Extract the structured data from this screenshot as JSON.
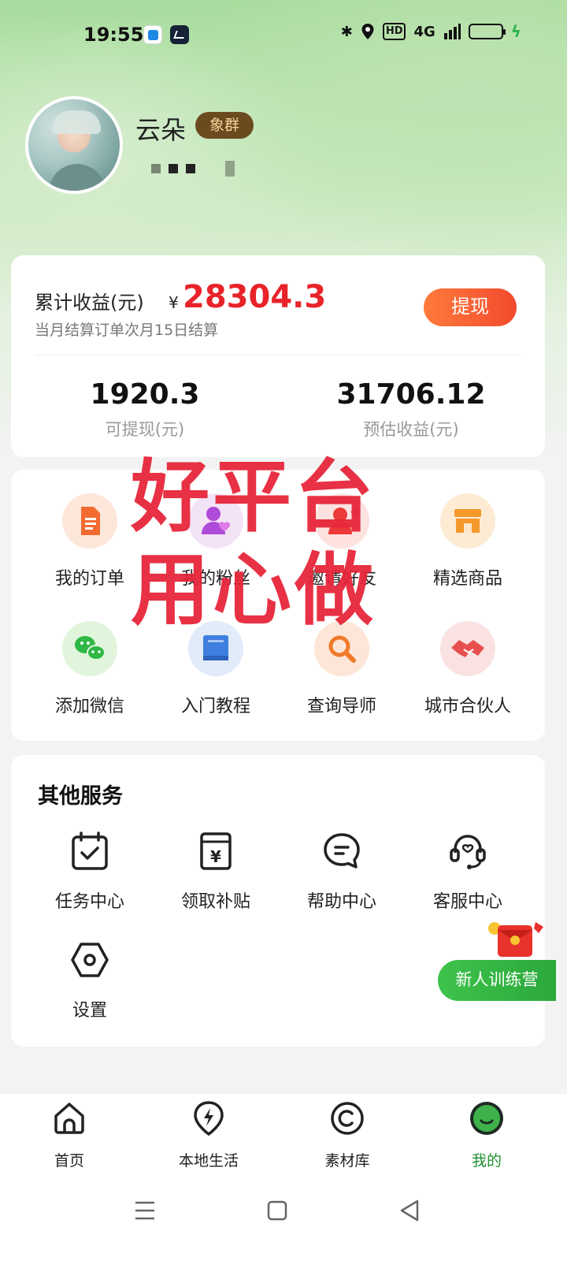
{
  "status_bar": {
    "time": "19:55",
    "network": "4G",
    "hd": "HD"
  },
  "profile": {
    "username": "云朵",
    "level_badge": "象群"
  },
  "earnings": {
    "title": "累计收益(元)",
    "currency": "¥",
    "total": "28304.3",
    "note": "当月结算订单次月15日结算",
    "withdraw_label": "提现",
    "stats": [
      {
        "value": "1920.3",
        "label": "可提现(元)"
      },
      {
        "value": "31706.12",
        "label": "预估收益(元)"
      }
    ]
  },
  "overlay": {
    "line1": "好平台",
    "line2": "用心做"
  },
  "features": [
    {
      "label": "我的订单",
      "icon": "order-doc-icon",
      "color": "#f26b30"
    },
    {
      "label": "我的粉丝",
      "icon": "fans-heart-icon",
      "color": "#b04ad8"
    },
    {
      "label": "邀请好友",
      "icon": "invite-friend-icon",
      "color": "#ec3a3a"
    },
    {
      "label": "精选商品",
      "icon": "store-icon",
      "color": "#f5992b"
    },
    {
      "label": "添加微信",
      "icon": "wechat-icon",
      "color": "#2fb845"
    },
    {
      "label": "入门教程",
      "icon": "book-icon",
      "color": "#3f7fe0"
    },
    {
      "label": "查询导师",
      "icon": "search-icon",
      "color": "#f07a2a"
    },
    {
      "label": "城市合伙人",
      "icon": "handshake-icon",
      "color": "#e85050"
    }
  ],
  "other_services": {
    "title": "其他服务",
    "items": [
      {
        "label": "任务中心",
        "icon": "task-calendar-icon"
      },
      {
        "label": "领取补贴",
        "icon": "subsidy-yen-icon"
      },
      {
        "label": "帮助中心",
        "icon": "help-chat-icon"
      },
      {
        "label": "客服中心",
        "icon": "customer-service-icon"
      },
      {
        "label": "设置",
        "icon": "settings-hex-icon"
      }
    ]
  },
  "promo": {
    "label": "新人训练营"
  },
  "bottom_nav": [
    {
      "label": "首页",
      "icon": "home-icon",
      "active": false
    },
    {
      "label": "本地生活",
      "icon": "local-life-bolt-icon",
      "active": false
    },
    {
      "label": "素材库",
      "icon": "material-icon",
      "active": false
    },
    {
      "label": "我的",
      "icon": "me-avatar-icon",
      "active": true
    }
  ],
  "colors": {
    "accent_red": "#e8232a",
    "brand_green": "#2ba83b",
    "withdraw_orange": "#f24b2e"
  }
}
